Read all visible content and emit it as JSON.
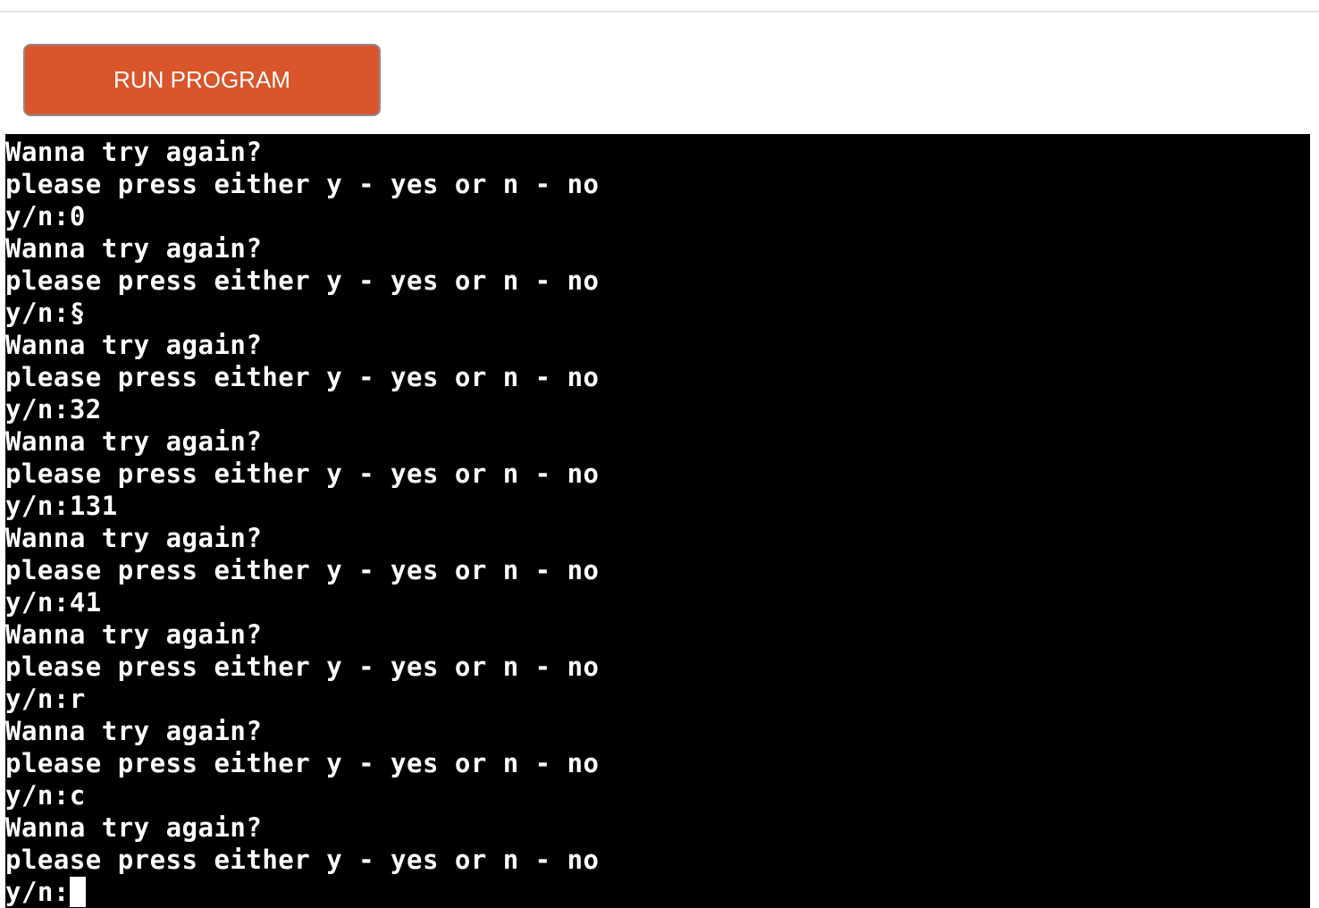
{
  "toolbar": {
    "run_label": "RUN PROGRAM"
  },
  "terminal": {
    "lines": [
      "Wanna try again?",
      "please press either y - yes or n - no",
      "y/n:0",
      "Wanna try again?",
      "please press either y - yes or n - no",
      "y/n:§",
      "Wanna try again?",
      "please press either y - yes or n - no",
      "y/n:32",
      "Wanna try again?",
      "please press either y - yes or n - no",
      "y/n:131",
      "Wanna try again?",
      "please press either y - yes or n - no",
      "y/n:41",
      "Wanna try again?",
      "please press either y - yes or n - no",
      "y/n:r",
      "Wanna try again?",
      "please press either y - yes or n - no",
      "y/n:c",
      "Wanna try again?",
      "please press either y - yes or n - no"
    ],
    "prompt": "y/n:"
  },
  "colors": {
    "button_bg": "#d9552b",
    "terminal_bg": "#000000",
    "terminal_fg": "#ffffff"
  }
}
